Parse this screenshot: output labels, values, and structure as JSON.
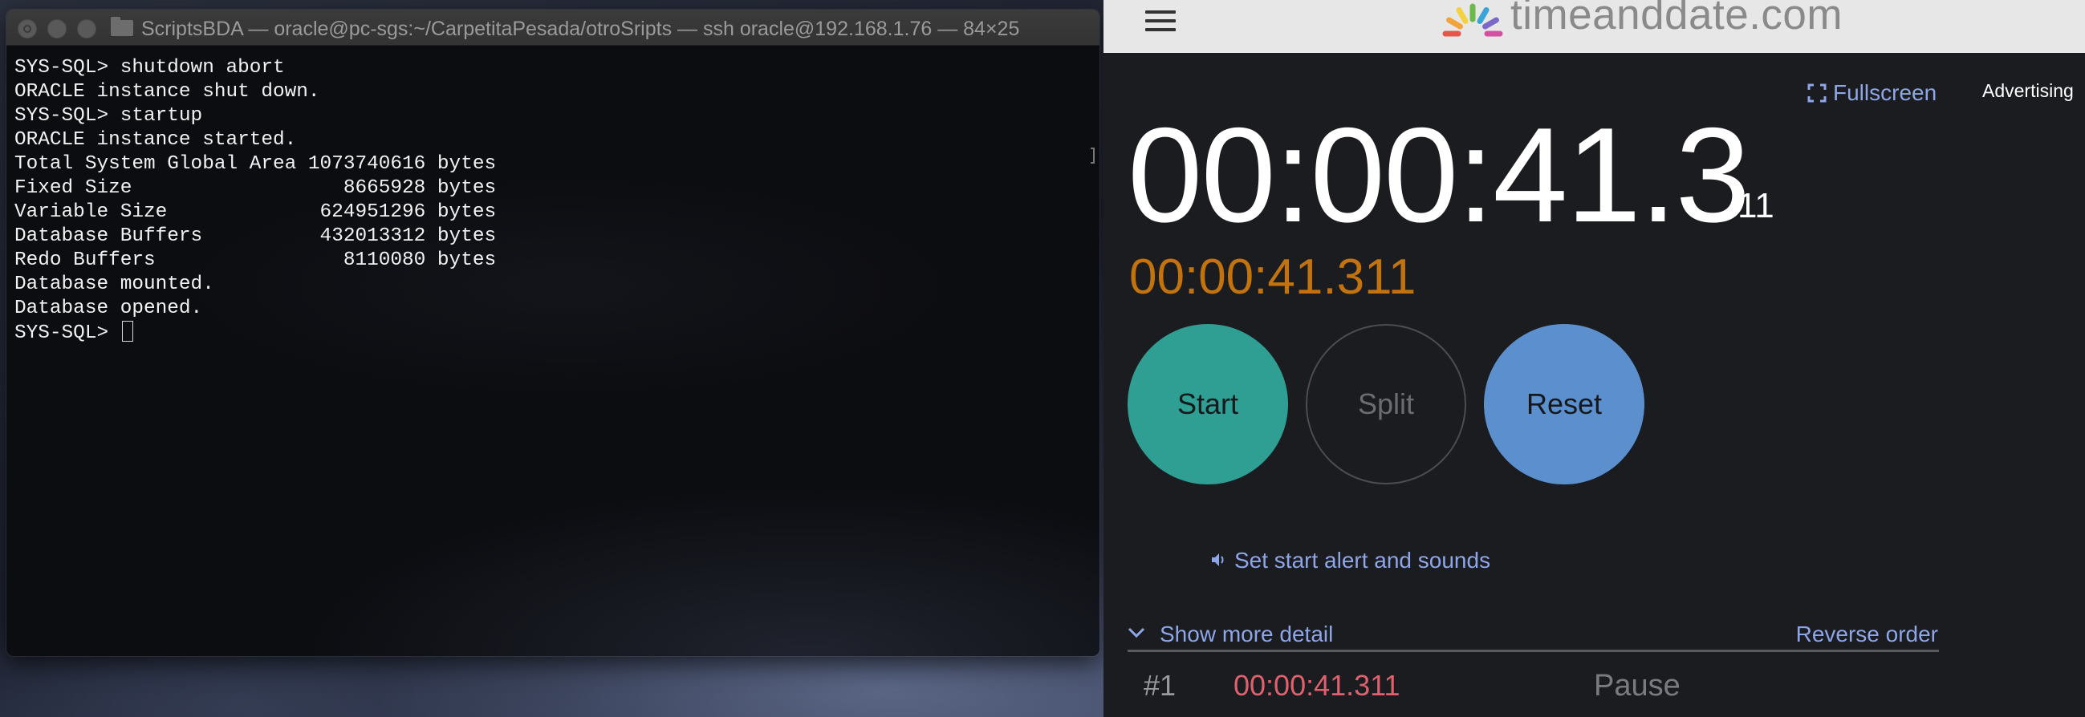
{
  "terminal": {
    "title": "ScriptsBDA — oracle@pc-sgs:~/CarpetitaPesada/otroSripts — ssh oracle@192.168.1.76 — 84×25",
    "lines": [
      "SYS-SQL> shutdown abort",
      "ORACLE instance shut down.",
      "SYS-SQL> startup",
      "ORACLE instance started.",
      "Total System Global Area 1073740616 bytes",
      "Fixed Size                  8665928 bytes",
      "Variable Size             624951296 bytes",
      "Database Buffers          432013312 bytes",
      "Redo Buffers                8110080 bytes",
      "Database mounted.",
      "Database opened.",
      "SYS-SQL> "
    ]
  },
  "site": {
    "logo_text": "timeanddate.com",
    "fullscreen_label": "Fullscreen",
    "advertising_label": "Advertising",
    "logo_colors": [
      "#e4574b",
      "#f2a33a",
      "#f3d13f",
      "#6cb94e",
      "#3aa3d8",
      "#7b68c9",
      "#d64fa0"
    ]
  },
  "stopwatch": {
    "main_time": "00:00:41.3",
    "main_time_ms": "11",
    "secondary_time": "00:00:41.311",
    "start_label": "Start",
    "split_label": "Split",
    "reset_label": "Reset",
    "alert_link": "Set start alert and sounds",
    "show_more_label": "Show more detail",
    "reverse_order_label": "Reverse order",
    "laps": [
      {
        "number": "#1",
        "time": "00:00:41.311",
        "label": "Pause"
      }
    ],
    "colors": {
      "start": "#2f9e93",
      "reset": "#5b8fce",
      "secondary_time": "#c3730d",
      "lap_time": "#e0616e",
      "link": "#8ea6e8"
    }
  }
}
